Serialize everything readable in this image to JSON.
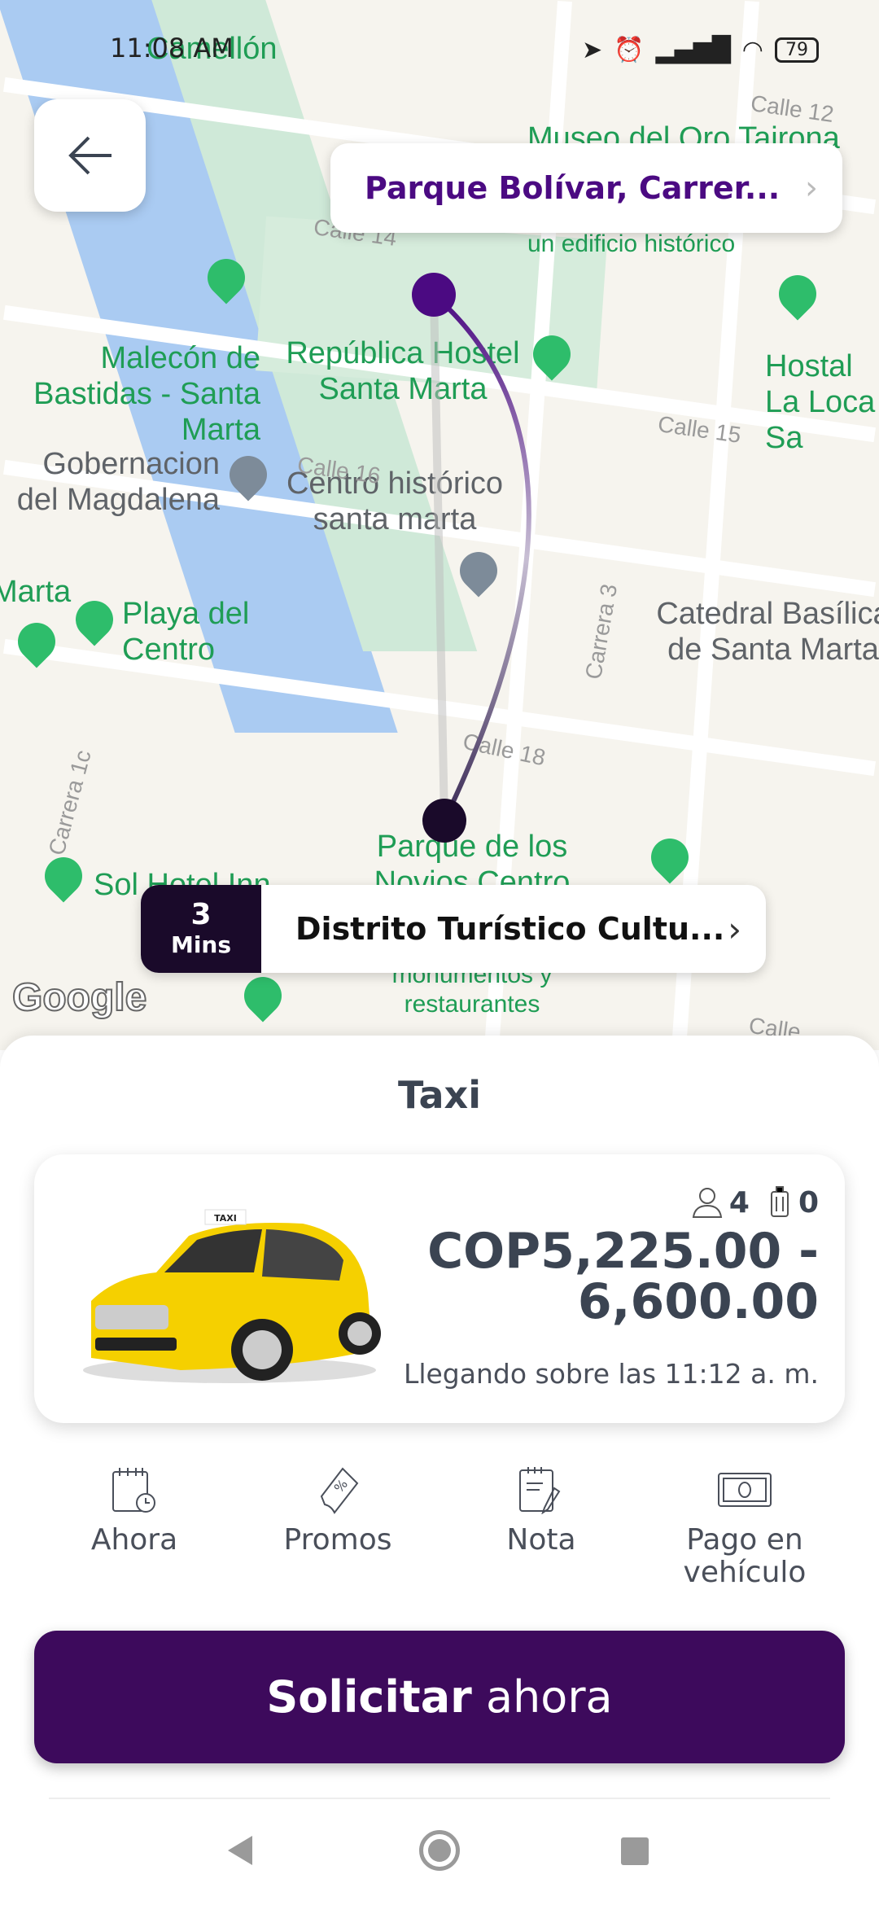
{
  "status_bar": {
    "time": "11:08 AM",
    "battery": "79"
  },
  "map": {
    "labels": [
      "Camellón",
      "Museo del Oro Tairona",
      "un edificio histórico",
      "Malecón de Bastidas - Santa Marta",
      "República Hostel Santa Marta",
      "Hostal La Loca Sa",
      "Gobernacion del Magdalena",
      "Centro histórico santa marta",
      "Marta",
      "Playa del Centro",
      "Catedral Basílica de Santa Marta",
      "Parque de los Novios Centro",
      "Sol Hotel Inn",
      "monumentos y restaurantes"
    ],
    "streets": [
      "Calle 12",
      "Calle 14",
      "Calle 15",
      "Calle 16",
      "Carrera 3",
      "Calle 18",
      "Carrera 1c",
      "Calle"
    ],
    "google_logo": "Google",
    "route_color": "#4b0a82"
  },
  "origin": {
    "label": "Parque Bolívar, Carrer..."
  },
  "destination": {
    "eta_value": "3",
    "eta_unit": "Mins",
    "label": "Distrito Turístico Cultu..."
  },
  "sheet": {
    "title": "Taxi",
    "vehicle": {
      "seats": "4",
      "luggage": "0",
      "price_line1": "COP5,225.00 -",
      "price_line2": "6,600.00",
      "arrival": "Llegando sobre las 11:12 a. m.",
      "roof_sign": "TAXI"
    },
    "options": [
      {
        "label": "Ahora",
        "icon": "calendar-clock"
      },
      {
        "label": "Promos",
        "icon": "ticket-percent"
      },
      {
        "label": "Nota",
        "icon": "notepad-pencil"
      },
      {
        "label": "Pago en vehículo",
        "icon": "cash"
      }
    ],
    "request_bold": "Solicitar",
    "request_light": " ahora",
    "accent": "#3d0a5c"
  }
}
